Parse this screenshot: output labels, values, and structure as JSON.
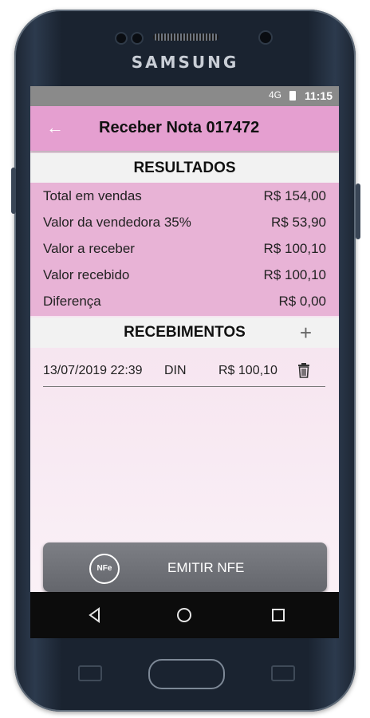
{
  "device": {
    "brand": "SAMSUNG"
  },
  "status_bar": {
    "time": "11:15",
    "signal_label": "4G"
  },
  "app_bar": {
    "back_icon": "arrow-left-icon",
    "title": "Receber Nota 017472"
  },
  "results": {
    "heading": "RESULTADOS",
    "rows": [
      {
        "label": "Total em vendas",
        "value": "R$ 154,00"
      },
      {
        "label": "Valor da vendedora 35%",
        "value": "R$ 53,90"
      },
      {
        "label": "Valor a receber",
        "value": "R$ 100,10"
      },
      {
        "label": "Valor recebido",
        "value": "R$ 100,10"
      },
      {
        "label": "Diferença",
        "value": "R$ 0,00"
      }
    ]
  },
  "receipts": {
    "heading": "RECEBIMENTOS",
    "add_icon": "plus-icon",
    "items": [
      {
        "datetime": "13/07/2019 22:39",
        "method": "DIN",
        "amount": "R$ 100,10",
        "delete_icon": "trash-icon"
      }
    ]
  },
  "actions": {
    "emit_label": "EMITIR NFE",
    "emit_icon": "nfe-icon",
    "emit_icon_text": "NFe"
  },
  "colors": {
    "app_bar": "#e59fd0",
    "results_bg": "#e8b3d6",
    "button": "#6e7076"
  }
}
